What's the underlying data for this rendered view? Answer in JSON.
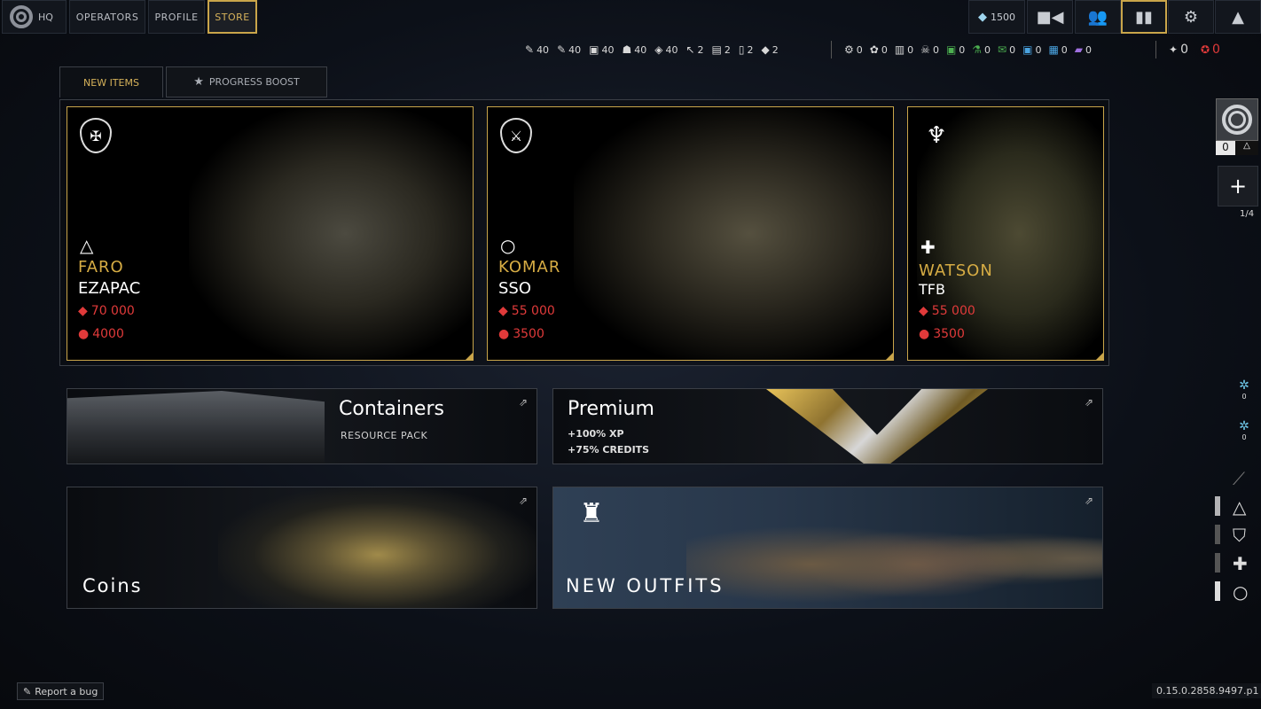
{
  "nav": {
    "hq": "HQ",
    "operators": "OPERATORS",
    "profile": "PROFILE",
    "store": "STORE",
    "credits": "1500"
  },
  "resources": {
    "left": [
      "40",
      "40",
      "40",
      "40",
      "40",
      "2",
      "2",
      "2",
      "2"
    ],
    "mid": [
      "0",
      "0",
      "0",
      "0",
      "0",
      "0",
      "0",
      "0",
      "0",
      "0"
    ],
    "right": [
      "0",
      "0"
    ]
  },
  "tabs": {
    "new_items": "NEW ITEMS",
    "progress_boost": "PROGRESS BOOST"
  },
  "operators": [
    {
      "name": "FARO",
      "unit": "EZAPAC",
      "price_main": "70 000",
      "price_alt": "4000",
      "role_symbol": "△"
    },
    {
      "name": "KOMAR",
      "unit": "SSO",
      "price_main": "55 000",
      "price_alt": "3500",
      "role_symbol": "○"
    },
    {
      "name": "WATSON",
      "unit": "TFB",
      "price_main": "55 000",
      "price_alt": "3500",
      "role_symbol": "✚"
    }
  ],
  "tiles": {
    "containers_title": "Containers",
    "containers_sub": "RESOURCE PACK",
    "premium_title": "Premium",
    "premium_line1": "+100% XP",
    "premium_line2": "+75% CREDITS",
    "coins_title": "Coins",
    "outfits_title": "NEW OUTFITS"
  },
  "sidebar": {
    "squad_count": "0",
    "slots": "1/4",
    "boost1": "0",
    "boost2": "0"
  },
  "footer": {
    "bug": "Report a bug",
    "version": "0.15.0.2858.9497.p1"
  },
  "colors": {
    "accent": "#c9a54a",
    "price": "#e03a3a",
    "name": "#d6ac44"
  }
}
